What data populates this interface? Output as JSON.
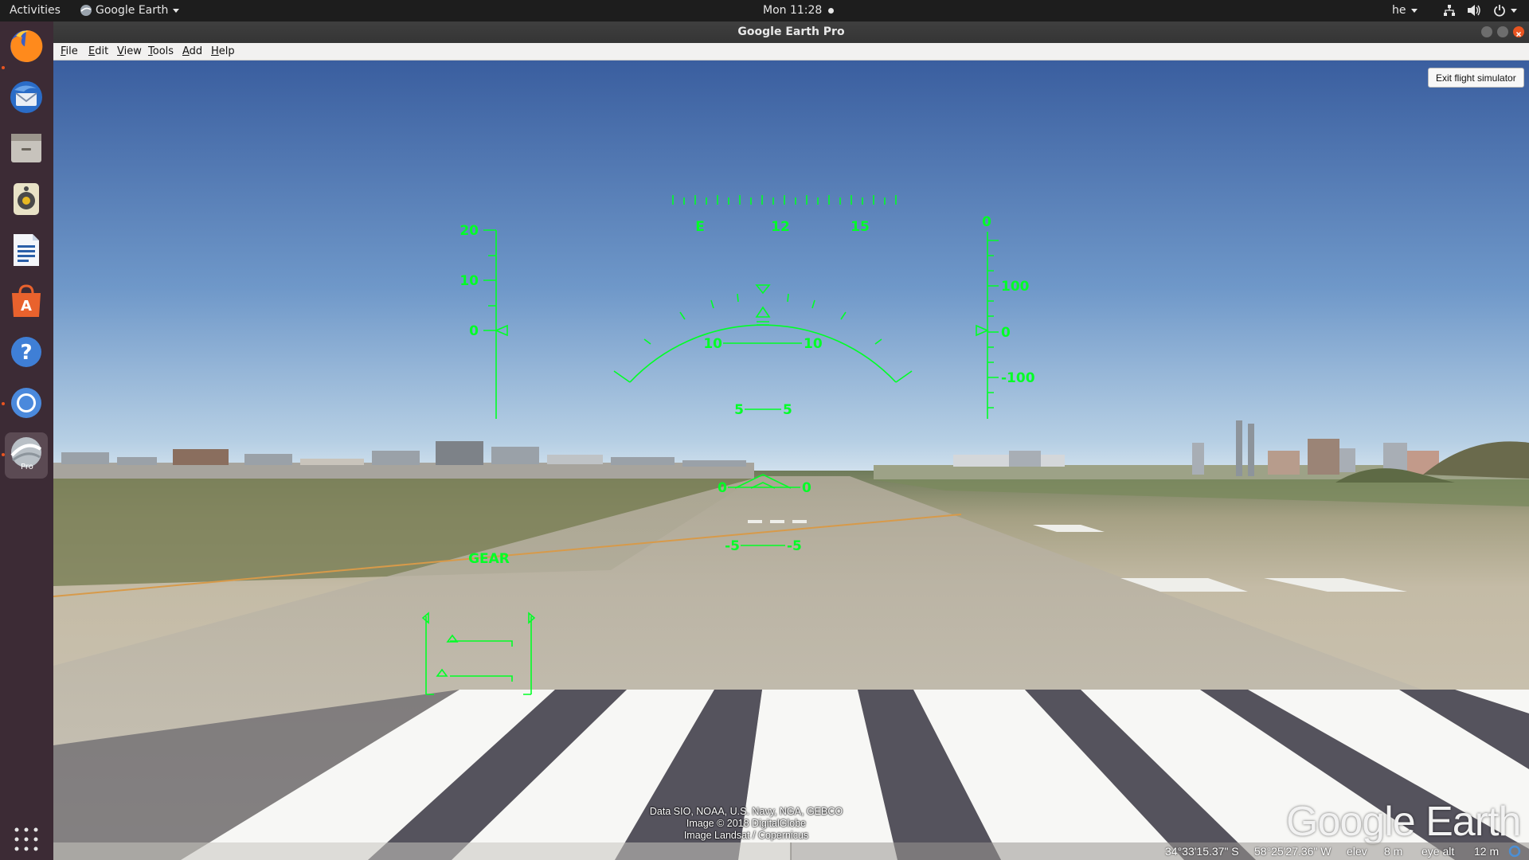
{
  "topbar": {
    "activities": "Activities",
    "app_menu": "Google Earth",
    "clock": "Mon 11:28",
    "lang": "he"
  },
  "dock": {
    "items": [
      "firefox-icon",
      "thunderbird-icon",
      "files-icon",
      "rhythmbox-icon",
      "writer-icon",
      "software-center-icon",
      "help-icon",
      "chromium-icon",
      "google-earth-pro-icon"
    ],
    "earth_badge": "Pro"
  },
  "window": {
    "title": "Google Earth Pro",
    "menu": [
      "File",
      "Edit",
      "View",
      "Tools",
      "Add",
      "Help"
    ]
  },
  "flight_sim": {
    "exit_label": "Exit flight simulator",
    "heading_labels": [
      "E",
      "12",
      "15"
    ],
    "speed_labels": [
      "20",
      "10",
      "0"
    ],
    "altitude_top": "0",
    "altitude_labels": [
      "100",
      "0",
      "-100"
    ],
    "pitch_labels": {
      "p10_left": "10",
      "p10_right": "10",
      "p5_left": "5",
      "p5_right": "5",
      "p0_left": "0",
      "p0_right": "0",
      "m5_left": "-5",
      "m5_right": "-5"
    },
    "gear_label": "GEAR"
  },
  "attribution": [
    "Data SIO, NOAA, U.S. Navy, NGA, GEBCO",
    "Image © 2018 DigitalGlobe",
    "Image Landsat / Copernicus"
  ],
  "logo": "Google Earth",
  "status": {
    "latitude": "34°33'15.37\" S",
    "longitude": "58°25'27.36\" W",
    "elev_label": "elev",
    "elev_value": "8 m",
    "eye_alt_label": "eye alt",
    "eye_alt_value": "12 m"
  },
  "colors": {
    "hud": "#00ff26",
    "sky_top": "#3b5fa0",
    "sky_horizon": "#c9dbe9",
    "accent": "#e95420"
  }
}
